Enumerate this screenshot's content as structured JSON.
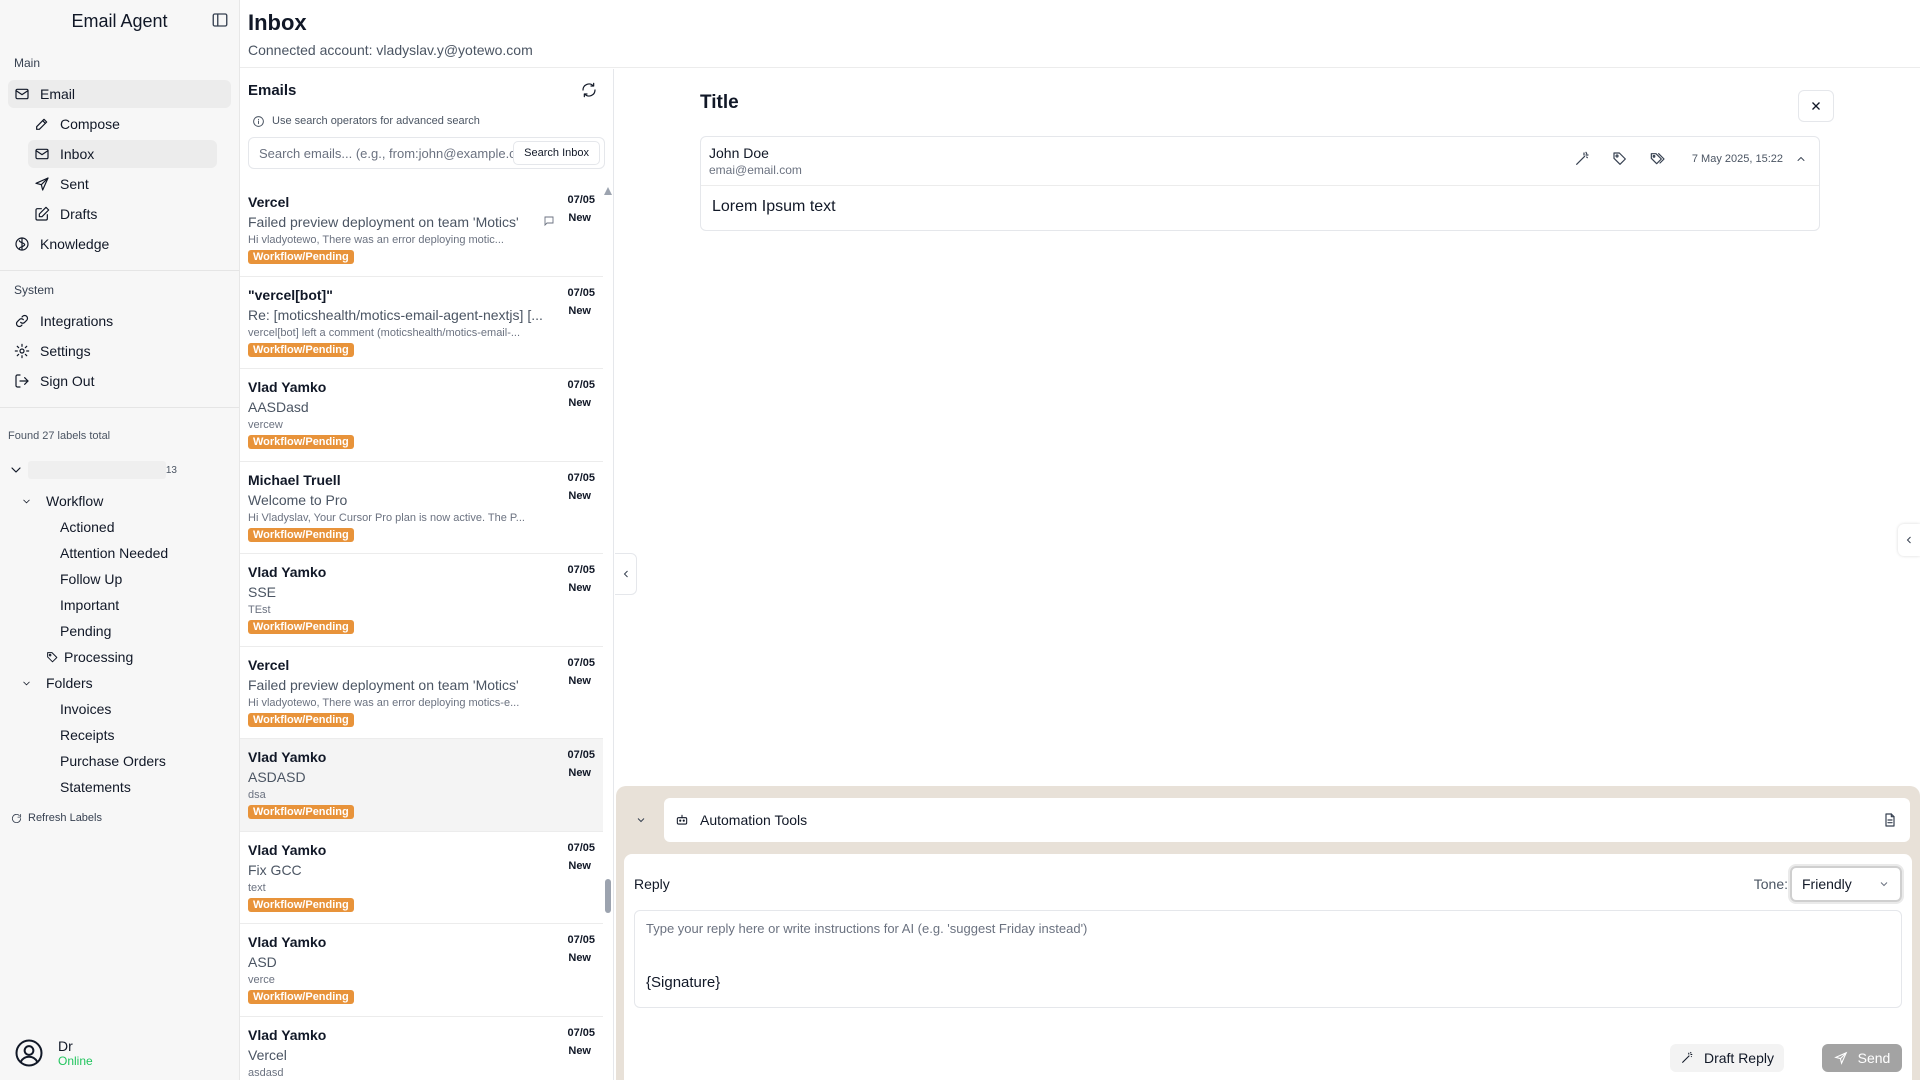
{
  "app": {
    "title": "Email Agent"
  },
  "sidebar": {
    "main_section": "Main",
    "email_label": "Email",
    "email_items": [
      {
        "label": "Compose",
        "icon": "pencil-icon"
      },
      {
        "label": "Inbox",
        "icon": "inbox-icon"
      },
      {
        "label": "Sent",
        "icon": "send-icon"
      },
      {
        "label": "Drafts",
        "icon": "edit-icon"
      }
    ],
    "knowledge_label": "Knowledge",
    "system_section": "System",
    "system_items": [
      {
        "label": "Integrations",
        "icon": "link-icon"
      },
      {
        "label": "Settings",
        "icon": "gear-icon"
      },
      {
        "label": "Sign Out",
        "icon": "sign-out-icon"
      }
    ],
    "labels_found": "Found 27 labels total",
    "root_count": "13",
    "workflow": {
      "label": "Workflow",
      "items": [
        "Actioned",
        "Attention Needed",
        "Follow Up",
        "Important",
        "Pending"
      ]
    },
    "processing_label": "Processing",
    "folders": {
      "label": "Folders",
      "items": [
        "Invoices",
        "Receipts",
        "Purchase Orders",
        "Statements"
      ]
    },
    "refresh_labels": "Refresh Labels",
    "user": {
      "name": "Dr",
      "status": "Online"
    }
  },
  "header": {
    "title": "Inbox",
    "subtitle": "Connected account: vladyslav.y@yotewo.com"
  },
  "email_list": {
    "title": "Emails",
    "hint": "Use search operators for advanced search",
    "search_placeholder": "Search emails... (e.g., from:john@example.com)",
    "search_button": "Search Inbox",
    "emails": [
      {
        "from": "Vercel",
        "subject": "Failed preview deployment on team 'Motics'",
        "snippet": "Hi vladyotewo, There was an error deploying motic...",
        "badge": "Workflow/Pending",
        "date": "07/05",
        "status": "New"
      },
      {
        "from": "\"vercel[bot]\"",
        "subject": "Re: [moticshealth/motics-email-agent-nextjs] [...",
        "snippet": "vercel[bot] left a comment (moticshealth/motics-email-...",
        "badge": "Workflow/Pending",
        "date": "07/05",
        "status": "New"
      },
      {
        "from": "Vlad Yamko",
        "subject": "AASDasd",
        "snippet": "vercew",
        "badge": "Workflow/Pending",
        "date": "07/05",
        "status": "New"
      },
      {
        "from": "Michael Truell",
        "subject": "Welcome to Pro",
        "snippet": "Hi Vladyslav, Your Cursor Pro plan is now active. The P...",
        "badge": "Workflow/Pending",
        "date": "07/05",
        "status": "New"
      },
      {
        "from": "Vlad Yamko",
        "subject": "SSE",
        "snippet": "TEst",
        "badge": "Workflow/Pending",
        "date": "07/05",
        "status": "New"
      },
      {
        "from": "Vercel",
        "subject": "Failed preview deployment on team 'Motics'",
        "snippet": "Hi vladyotewo, There was an error deploying motics-e...",
        "badge": "Workflow/Pending",
        "date": "07/05",
        "status": "New"
      },
      {
        "from": "Vlad Yamko",
        "subject": "ASDASD",
        "snippet": "dsa",
        "badge": "Workflow/Pending",
        "date": "07/05",
        "status": "New"
      },
      {
        "from": "Vlad Yamko",
        "subject": "Fix GCC",
        "snippet": "text",
        "badge": "Workflow/Pending",
        "date": "07/05",
        "status": "New"
      },
      {
        "from": "Vlad Yamko",
        "subject": "ASD",
        "snippet": "verce",
        "badge": "Workflow/Pending",
        "date": "07/05",
        "status": "New"
      },
      {
        "from": "Vlad Yamko",
        "subject": "Vercel",
        "snippet": "asdasd",
        "badge": "",
        "date": "07/05",
        "status": "New"
      }
    ]
  },
  "detail": {
    "title": "Title",
    "from_name": "John Doe",
    "from_email": "emai@email.com",
    "date": "7 May 2025, 15:22",
    "body": "Lorem Ipsum text"
  },
  "automation": {
    "label": "Automation Tools",
    "reply_label": "Reply",
    "tone_label": "Tone:",
    "tone_value": "Friendly",
    "reply_placeholder": "Type your reply here or write instructions for AI (e.g. 'suggest Friday instead')",
    "signature": "{Signature}",
    "draft_button": "Draft Reply",
    "send_button": "Send"
  },
  "colors": {
    "badge": "#e8933a",
    "online": "#22c55e",
    "panel": "#e8e1d8"
  }
}
